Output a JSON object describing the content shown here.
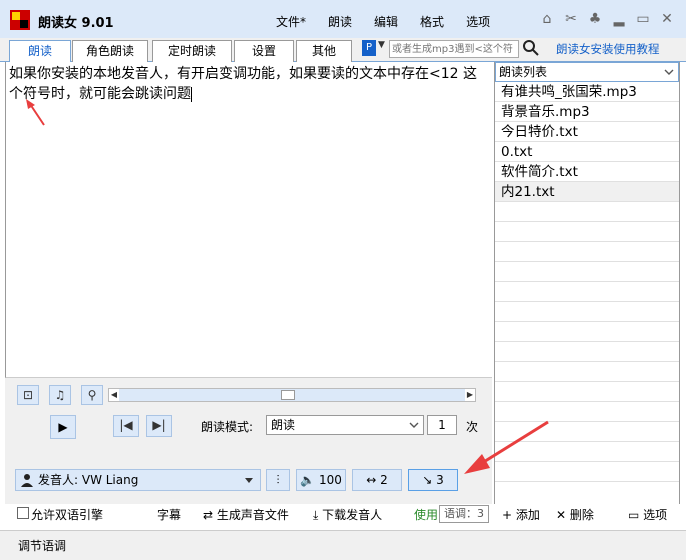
{
  "window": {
    "title": "朗读女 9.01",
    "menu": [
      "文件*",
      "朗读",
      "编辑",
      "格式",
      "选项"
    ]
  },
  "tabs": [
    "朗读",
    "角色朗读",
    "定时朗读",
    "设置",
    "其他"
  ],
  "search": {
    "placeholder": "或者生成mp3遇到<这个符"
  },
  "help_link": "朗读女安装使用教程",
  "editor_text": "如果你安装的本地发音人，有开启变调功能，如果要读的文本中存在<12 这个符号时，就可能会跳读问题",
  "playlist": {
    "header": "朗读列表",
    "items": [
      "有谁共鸣_张国荣.mp3",
      "背景音乐.mp3",
      "今日特价.txt",
      "0.txt",
      "软件简介.txt",
      "内21.txt"
    ]
  },
  "playback": {
    "mode_label": "朗读模式:",
    "mode_value": "朗读",
    "times_value": "1",
    "times_unit": "次"
  },
  "voice": {
    "label": "发音人: VW Liang",
    "volume": "100",
    "speed": "2",
    "pitch": "3"
  },
  "bottom": {
    "dual_engine_label": "允许双语引擎",
    "subtitle_btn": "字幕",
    "generate_btn": "生成声音文件",
    "download_btn": "下载发音人",
    "use_text": "使用",
    "add_btn": "添加",
    "delete_btn": "删除",
    "options_btn": "选项"
  },
  "tooltip": "语调：3",
  "status": "调节语调",
  "colors": {
    "accent": "#1561c9",
    "titlebar": "#dce9f9",
    "annotation_arrow": "#e83e3e"
  }
}
